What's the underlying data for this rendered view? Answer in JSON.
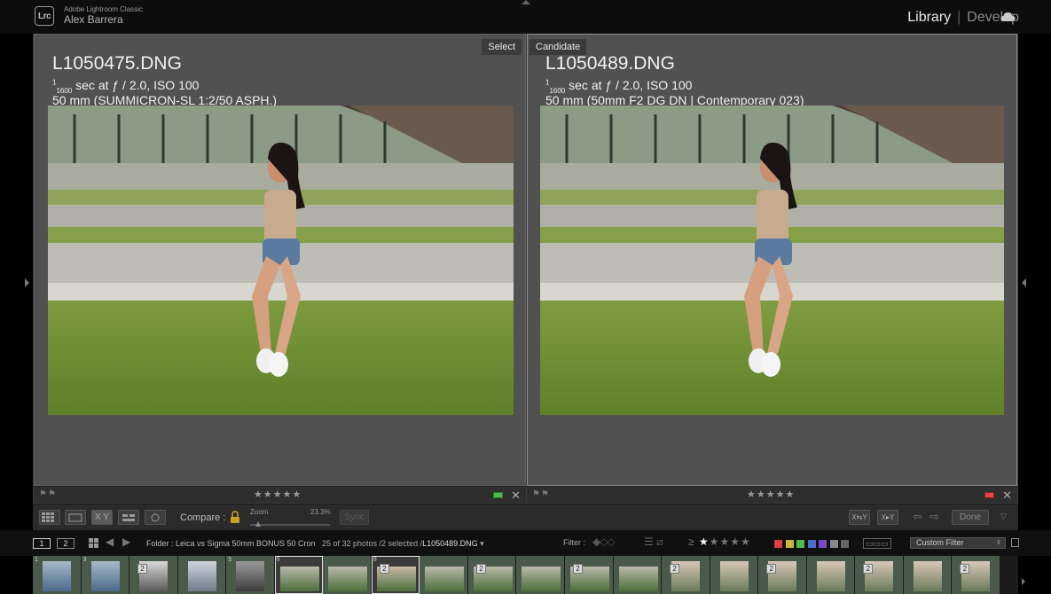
{
  "app": {
    "logo_text": "Lrc",
    "product_name": "Adobe Lightroom Classic",
    "user_name": "Alex Barrera"
  },
  "modules": {
    "library": "Library",
    "separator": "|",
    "develop": "Develop",
    "active": "Library"
  },
  "left_pane": {
    "tag": "Select",
    "filename": "L1050475.DNG",
    "shutter_num": "1",
    "shutter_den": "1600",
    "exposure_rest": "sec at ƒ / 2.0, ISO 100",
    "lens": "50 mm (SUMMICRON-SL 1:2/50 ASPH.)",
    "rating_stars": "★★★★★",
    "flags": "⚑⚑",
    "color_label": "#4cbb4c"
  },
  "right_pane": {
    "tag": "Candidate",
    "filename": "L1050489.DNG",
    "shutter_num": "1",
    "shutter_den": "1600",
    "exposure_rest": "sec at ƒ / 2.0, ISO 100",
    "lens": "50 mm (50mm F2 DG DN | Contemporary 023)",
    "rating_stars": "★★★★★",
    "flags": "⚑⚑",
    "color_label": "#e04848"
  },
  "toolbar": {
    "compare_label": "Compare :",
    "zoom_label": "Zoom",
    "zoom_value": "23.3%",
    "zoom_fraction": 0.1,
    "sync_label": "Sync",
    "done_label": "Done",
    "xy_label": "X Y"
  },
  "filterbar": {
    "monitor1": "1",
    "monitor2": "2",
    "folder_text": "Folder : Leica vs Sigma 50mm BONUS 50 Cron",
    "count_text": "25 of 32 photos /2 selected /",
    "current_file": "L1050489.DNG",
    "filter_label": "Filter :",
    "rating_op": "≥",
    "rating_filter_stars": 1,
    "stars": "★★★★★",
    "custom_filter": "Custom Filter",
    "colors": [
      "#d94040",
      "#c9b63a",
      "#4cbb4c",
      "#4a6fc9",
      "#7a4ac9",
      "#888888",
      "#666666"
    ]
  },
  "filmstrip": {
    "cells": [
      {
        "num": "1",
        "stack": "",
        "land": false,
        "bg": "#4a6a8a",
        "fg": "#a9b9c9",
        "sel": false
      },
      {
        "num": "3",
        "stack": "",
        "land": false,
        "bg": "#4a6a8a",
        "fg": "#a9b9c9",
        "sel": false
      },
      {
        "num": "",
        "stack": "2",
        "land": false,
        "bg": "#5a5a5a",
        "fg": "#d8d8d8",
        "sel": false
      },
      {
        "num": "",
        "stack": "",
        "land": false,
        "bg": "#6d7a8a",
        "fg": "#cfd6df",
        "sel": false
      },
      {
        "num": "5",
        "stack": "",
        "land": false,
        "bg": "#3d3d3d",
        "fg": "#9a9a9a",
        "sel": false
      },
      {
        "num": "6",
        "stack": "",
        "land": true,
        "bg": "#4d6e3a",
        "fg": "#b9b9a9",
        "sel": true
      },
      {
        "num": "",
        "stack": "",
        "land": true,
        "bg": "#4d6e3a",
        "fg": "#b9b9a9",
        "sel": false
      },
      {
        "num": "8",
        "stack": "2",
        "land": true,
        "bg": "#4d6e3a",
        "fg": "#c9b9a9",
        "sel": true
      },
      {
        "num": "",
        "stack": "",
        "land": true,
        "bg": "#4d6e3a",
        "fg": "#b9b9a9",
        "sel": false
      },
      {
        "num": "",
        "stack": "2",
        "land": true,
        "bg": "#4d6e3a",
        "fg": "#b9b9a9",
        "sel": false
      },
      {
        "num": "",
        "stack": "",
        "land": true,
        "bg": "#4d6e3a",
        "fg": "#b9b9a9",
        "sel": false
      },
      {
        "num": "",
        "stack": "2",
        "land": true,
        "bg": "#4d6e3a",
        "fg": "#b9b9a9",
        "sel": false
      },
      {
        "num": "",
        "stack": "",
        "land": true,
        "bg": "#4d6e3a",
        "fg": "#b9b9a9",
        "sel": false
      },
      {
        "num": "",
        "stack": "2",
        "land": false,
        "bg": "#6a7a5a",
        "fg": "#d8c8b8",
        "sel": false
      },
      {
        "num": "",
        "stack": "",
        "land": false,
        "bg": "#6a7a5a",
        "fg": "#d8c8b8",
        "sel": false
      },
      {
        "num": "",
        "stack": "2",
        "land": false,
        "bg": "#6a7a5a",
        "fg": "#d8c8b8",
        "sel": false
      },
      {
        "num": "",
        "stack": "",
        "land": false,
        "bg": "#6a7a5a",
        "fg": "#d8c8b8",
        "sel": false
      },
      {
        "num": "",
        "stack": "2",
        "land": false,
        "bg": "#6a7a5a",
        "fg": "#d8c8b8",
        "sel": false
      },
      {
        "num": "",
        "stack": "",
        "land": false,
        "bg": "#6a7a5a",
        "fg": "#d8c8b8",
        "sel": false
      },
      {
        "num": "",
        "stack": "2",
        "land": false,
        "bg": "#6a7a5a",
        "fg": "#d8c8b8",
        "sel": false
      }
    ]
  }
}
